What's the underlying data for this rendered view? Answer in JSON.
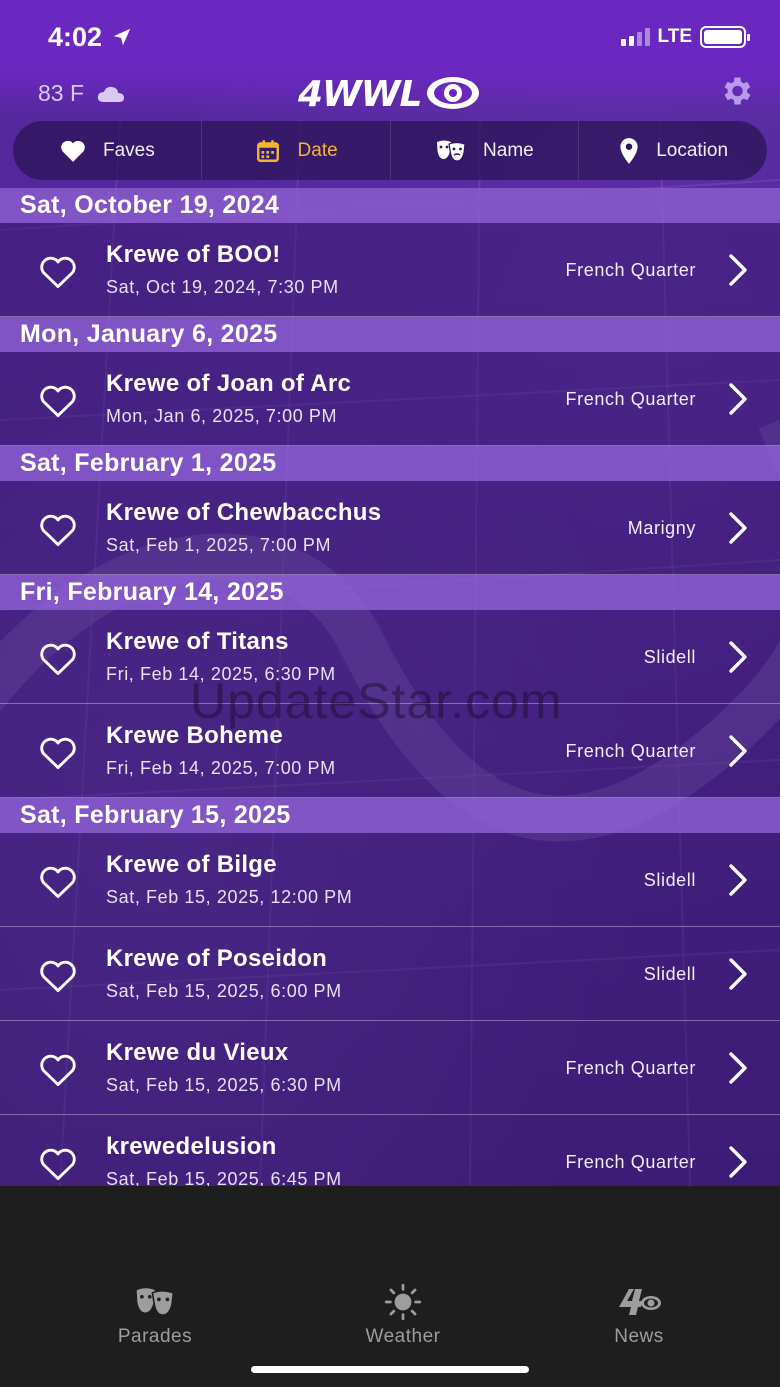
{
  "status": {
    "time": "4:02",
    "network": "LTE"
  },
  "header": {
    "temperature": "83 F",
    "logo": "4WWL"
  },
  "filters": [
    {
      "label": "Faves",
      "icon": "heart-icon"
    },
    {
      "label": "Date",
      "icon": "calendar-icon",
      "active": true
    },
    {
      "label": "Name",
      "icon": "masks-icon"
    },
    {
      "label": "Location",
      "icon": "location-pin-icon"
    }
  ],
  "groups": [
    {
      "date": "Sat, October 19, 2024",
      "events": [
        {
          "name": "Krewe of BOO!",
          "when": "Sat, Oct 19, 2024, 7:30 PM",
          "location": "French Quarter"
        }
      ]
    },
    {
      "date": "Mon, January 6, 2025",
      "events": [
        {
          "name": "Krewe of Joan of Arc",
          "when": "Mon, Jan 6, 2025, 7:00 PM",
          "location": "French Quarter"
        }
      ]
    },
    {
      "date": "Sat, February 1, 2025",
      "events": [
        {
          "name": "Krewe of Chewbacchus",
          "when": "Sat, Feb 1, 2025, 7:00 PM",
          "location": "Marigny"
        }
      ]
    },
    {
      "date": "Fri, February 14, 2025",
      "events": [
        {
          "name": "Krewe of Titans",
          "when": "Fri, Feb 14, 2025, 6:30 PM",
          "location": "Slidell"
        },
        {
          "name": "Krewe Boheme",
          "when": "Fri, Feb 14, 2025, 7:00 PM",
          "location": "French Quarter"
        }
      ]
    },
    {
      "date": "Sat, February 15, 2025",
      "events": [
        {
          "name": "Krewe of Bilge",
          "when": "Sat, Feb 15, 2025, 12:00 PM",
          "location": "Slidell"
        },
        {
          "name": "Krewe of Poseidon",
          "when": "Sat, Feb 15, 2025, 6:00 PM",
          "location": "Slidell"
        },
        {
          "name": "Krewe du Vieux",
          "when": "Sat, Feb 15, 2025, 6:30 PM",
          "location": "French Quarter"
        },
        {
          "name": "krewedelusion",
          "when": "Sat, Feb 15, 2025, 6:45 PM",
          "location": "French Quarter"
        }
      ]
    }
  ],
  "watermark": "UpdateStar.com",
  "tabs": [
    {
      "label": "Parades",
      "icon": "masks-icon"
    },
    {
      "label": "Weather",
      "icon": "sun-icon"
    },
    {
      "label": "News",
      "icon": "channel-logo-icon"
    }
  ],
  "colors": {
    "brand_purple": "#6a28c0",
    "active_filter": "#f2b731",
    "tab_inactive": "#9d9d9d"
  }
}
